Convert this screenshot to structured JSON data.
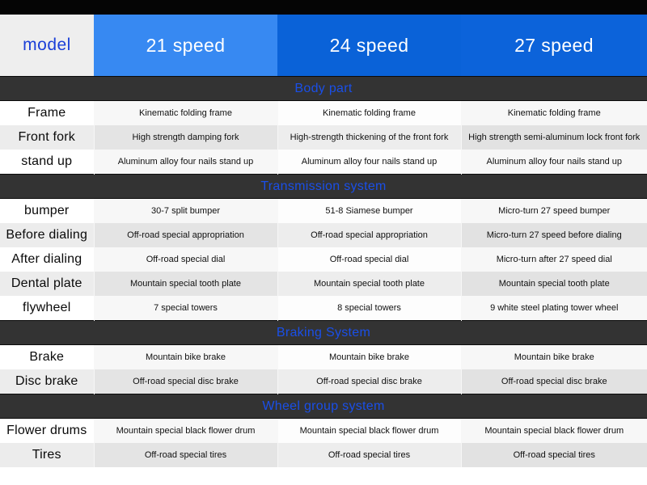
{
  "header": {
    "model_label": "model",
    "columns": [
      "21 speed",
      "24 speed",
      "27 speed"
    ]
  },
  "sections": [
    {
      "title": "Body part",
      "rows": [
        {
          "label": "Frame",
          "values": [
            "Kinematic folding frame",
            "Kinematic folding frame",
            "Kinematic folding frame"
          ]
        },
        {
          "label": "Front fork",
          "values": [
            "High strength damping fork",
            "High-strength thickening of the front fork",
            "High strength semi-aluminum lock front fork"
          ]
        },
        {
          "label": "stand up",
          "values": [
            "Aluminum alloy four nails stand up",
            "Aluminum alloy four nails stand up",
            "Aluminum alloy four nails stand up"
          ]
        }
      ]
    },
    {
      "title": "Transmission system",
      "rows": [
        {
          "label": "bumper",
          "values": [
            "30-7 split bumper",
            "51-8 Siamese bumper",
            "Micro-turn 27 speed bumper"
          ]
        },
        {
          "label": "Before dialing",
          "values": [
            "Off-road special appropriation",
            "Off-road special appropriation",
            "Micro-turn 27 speed before dialing"
          ]
        },
        {
          "label": "After dialing",
          "values": [
            "Off-road special dial",
            "Off-road special dial",
            "Micro-turn after 27 speed dial"
          ]
        },
        {
          "label": "Dental plate",
          "values": [
            "Mountain special tooth plate",
            "Mountain special tooth plate",
            "Mountain special tooth plate"
          ]
        },
        {
          "label": "flywheel",
          "values": [
            "7 special towers",
            "8 special towers",
            "9 white steel plating tower wheel"
          ]
        }
      ]
    },
    {
      "title": "Braking System",
      "rows": [
        {
          "label": "Brake",
          "values": [
            "Mountain bike brake",
            "Mountain bike brake",
            "Mountain bike brake"
          ]
        },
        {
          "label": "Disc brake",
          "values": [
            "Off-road special disc brake",
            "Off-road special disc brake",
            "Off-road special disc brake"
          ]
        }
      ]
    },
    {
      "title": "Wheel group system",
      "rows": [
        {
          "label": "Flower drums",
          "values": [
            "Mountain special black flower drum",
            "Mountain special black flower drum",
            "Mountain special black flower drum"
          ]
        },
        {
          "label": "Tires",
          "values": [
            "Off-road special tires",
            "Off-road special tires",
            "Off-road special tires"
          ]
        }
      ]
    }
  ],
  "colors": {
    "accent_blue_light": "#3789f2",
    "accent_blue_dark": "#0a62d8",
    "section_band": "#333333",
    "section_text": "#1a4fe8",
    "model_text": "#1a3fd8"
  }
}
